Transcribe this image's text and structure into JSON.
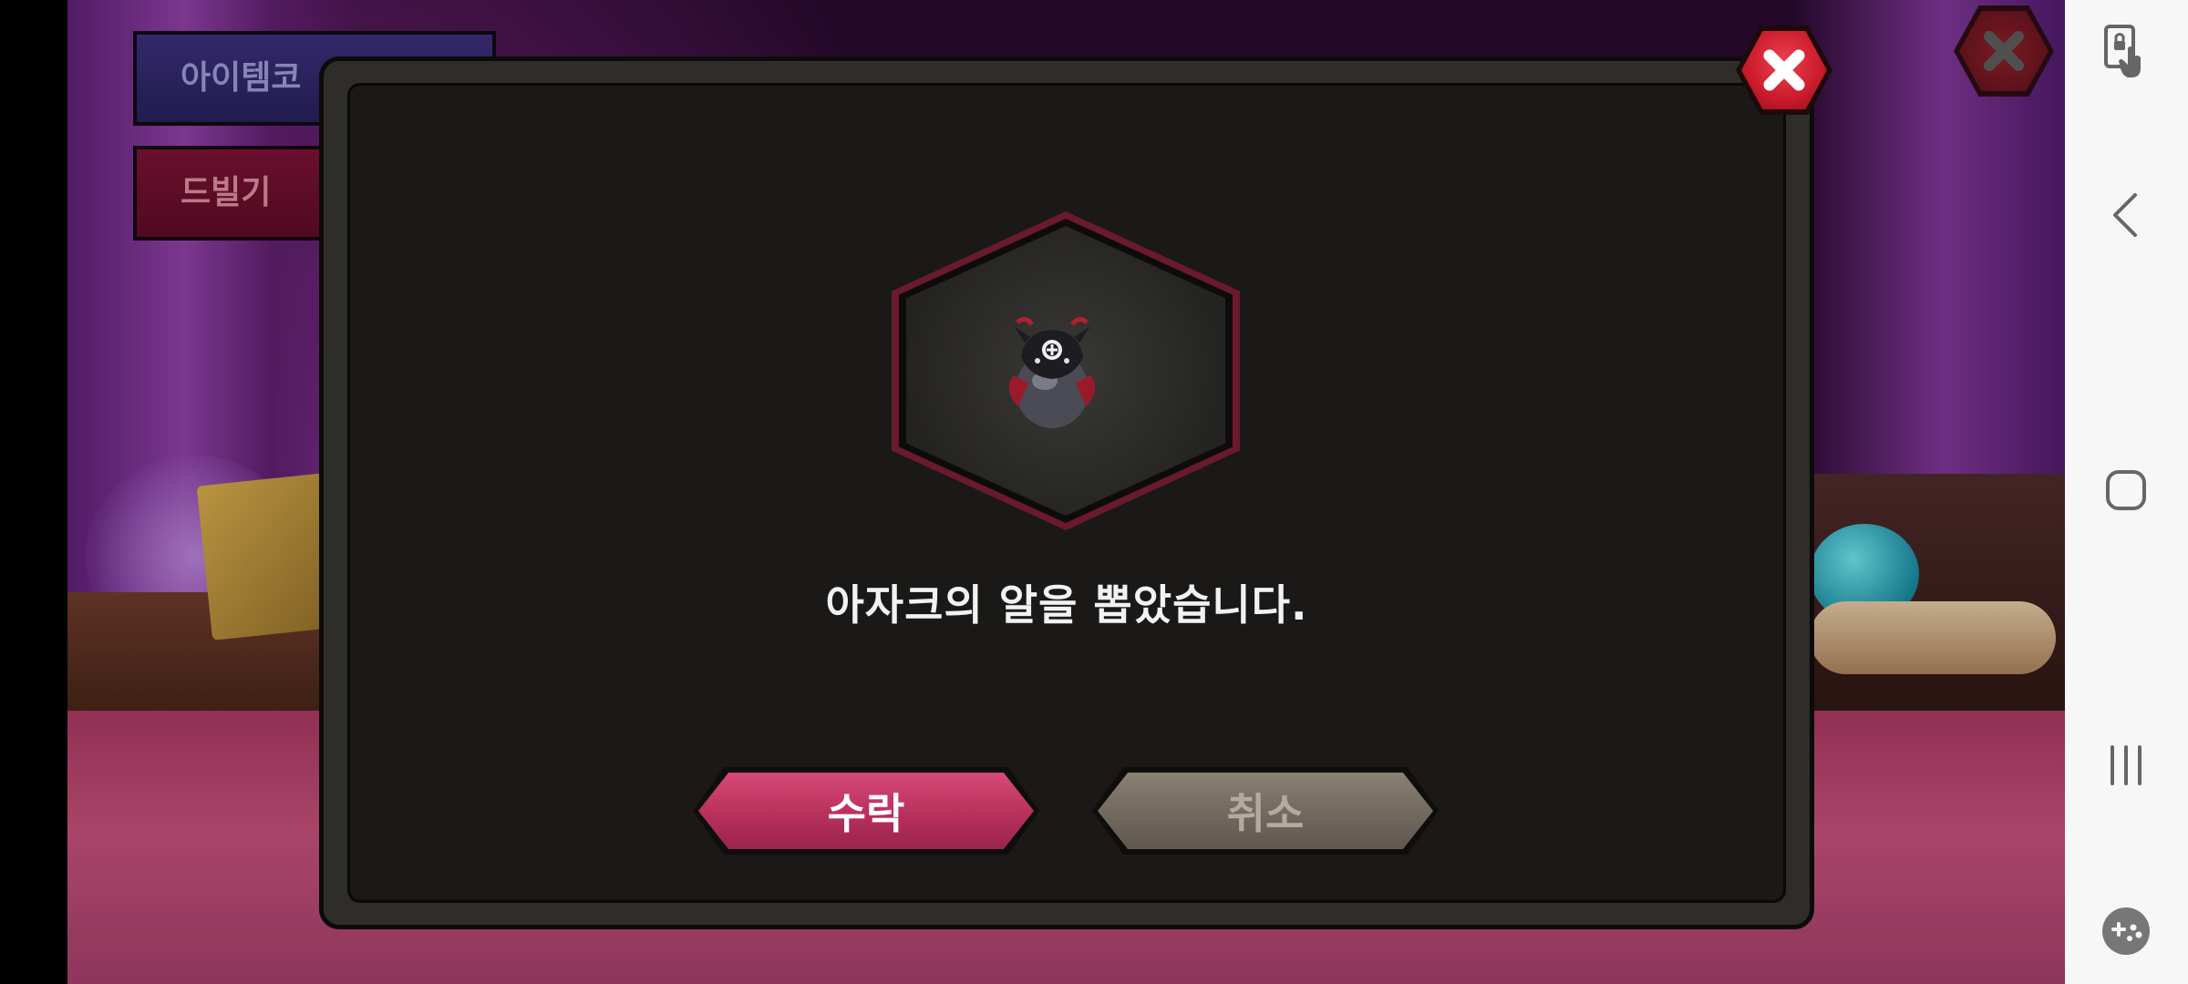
{
  "background": {
    "menu_button_1_label": "아이템코",
    "menu_button_2_label": "드빌기"
  },
  "dialog": {
    "message": "아자크의 알을 뽑았습니다.",
    "item_icon": "azak-egg-icon",
    "accept_label": "수락",
    "cancel_label": "취소",
    "close_icon": "close-icon"
  },
  "navigation_bar": {
    "icons": [
      "screen-touch-lock-icon",
      "back-icon",
      "home-icon",
      "recents-icon",
      "game-tools-icon"
    ]
  },
  "colors": {
    "accept_button": "#c23a66",
    "cancel_button": "#756b60",
    "dialog_panel": "#1a1917",
    "close_button": "#d42030"
  }
}
